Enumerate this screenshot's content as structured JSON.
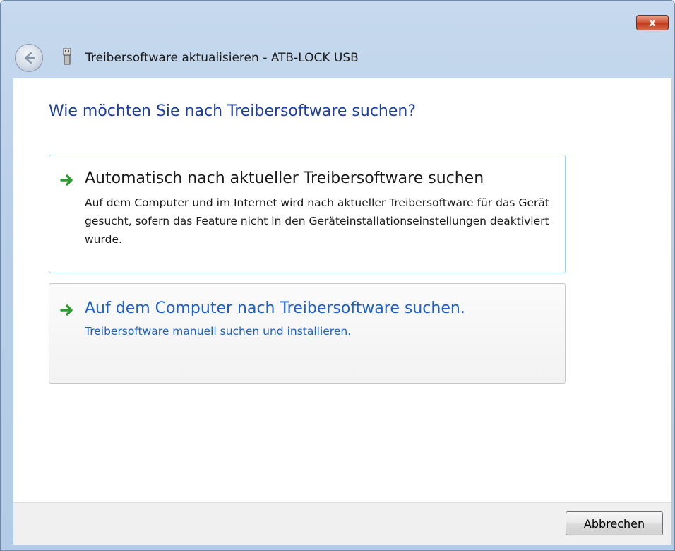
{
  "window": {
    "title": "Treibersoftware aktualisieren - ATB-LOCK USB",
    "close_label": "x"
  },
  "main": {
    "heading": "Wie möchten Sie nach Treibersoftware suchen?",
    "options": [
      {
        "title": "Automatisch nach aktueller Treibersoftware suchen",
        "description": "Auf dem Computer und im Internet wird nach aktueller Treibersoftware für das Gerät gesucht, sofern das Feature nicht in den Geräteinstallationseinstellungen deaktiviert wurde."
      },
      {
        "title": "Auf dem Computer nach Treibersoftware suchen.",
        "description": "Treibersoftware manuell suchen und installieren."
      }
    ]
  },
  "footer": {
    "cancel_label": "Abbrechen"
  },
  "icons": {
    "back": "back-arrow-icon",
    "device": "usb-device-icon",
    "option_arrow": "green-arrow-icon"
  },
  "colors": {
    "heading": "#1e3f9a",
    "link": "#1e5fc8",
    "arrow": "#2e9b2e",
    "close": "#c2391b"
  }
}
